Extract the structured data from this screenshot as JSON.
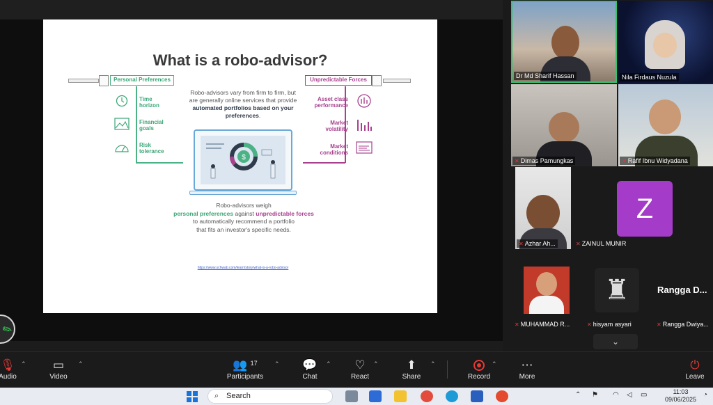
{
  "slide": {
    "title": "What is a robo-advisor?",
    "personal_preferences_label": "Personal Preferences",
    "unpredictable_forces_label": "Unpredictable Forces",
    "left_items": [
      {
        "line1": "Time",
        "line2": "horizon"
      },
      {
        "line1": "Financial",
        "line2": "goals"
      },
      {
        "line1": "Risk",
        "line2": "tolerance"
      }
    ],
    "right_items": [
      {
        "line1": "Asset class",
        "line2": "performance"
      },
      {
        "line1": "Market",
        "line2": "volatility"
      },
      {
        "line1": "Market",
        "line2": "conditions"
      }
    ],
    "center_text_plain": "Robo-advisors vary from firm to firm, but are generally online services that provide",
    "center_text_bold": "automated portfolios based on your preferences",
    "center_text_end": ".",
    "bottom_line1": "Robo-advisors weigh",
    "bottom_green": "personal preferences",
    "bottom_mid": " against ",
    "bottom_purple": "unpredictable forces",
    "bottom_line3": "to automatically recommend a portfolio",
    "bottom_line4": "that fits an investor's specific needs.",
    "link": "https://www.schwab.com/learn/story/what-is-a-robo-advisor",
    "colors": {
      "green": "#3aa576",
      "purple": "#a8408f",
      "blue": "#6aa8d8"
    }
  },
  "participants": [
    {
      "name": "Dr Md Sharif Hassan",
      "muted": false,
      "active": true
    },
    {
      "name": "Nila Firdaus Nuzula",
      "muted": false
    },
    {
      "name": "Dimas Pamungkas",
      "muted": true
    },
    {
      "name": "Rafif Ibnu Widyadana",
      "muted": true
    },
    {
      "name": "Azhar Ah...",
      "muted": true
    },
    {
      "name": "ZAINUL MUNIR",
      "muted": true,
      "initial": "Z"
    },
    {
      "name": "MUHAMMAD R...",
      "muted": true
    },
    {
      "name": "hisyam asyari",
      "muted": true
    },
    {
      "name": "Rangga Dwiya...",
      "muted": true,
      "display": "Rangga D..."
    }
  ],
  "toolbar": {
    "audio": "Audio",
    "video": "Video",
    "participants": "Participants",
    "participants_count": "17",
    "chat": "Chat",
    "react": "React",
    "share": "Share",
    "record": "Record",
    "more": "More",
    "leave": "Leave"
  },
  "taskbar": {
    "search_placeholder": "Search",
    "time": "11:03",
    "date": "09/06/2025"
  }
}
